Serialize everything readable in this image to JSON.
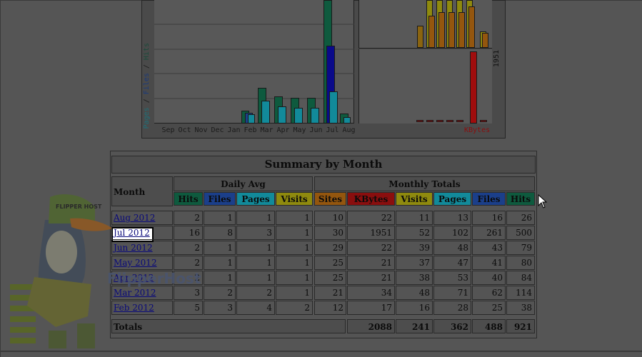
{
  "chart": {
    "y_label_pages": "Pages",
    "y_label_slash1": " / ",
    "y_label_files": "Files",
    "y_label_slash2": " / ",
    "y_label_hits": "Hits",
    "kbytes_max_label": "1951",
    "kbytes_label": "KBytes",
    "months": [
      "Sep",
      "Oct",
      "Nov",
      "Dec",
      "Jan",
      "Feb",
      "Mar",
      "Apr",
      "May",
      "Jun",
      "Jul",
      "Aug"
    ]
  },
  "table": {
    "title": "Summary by Month",
    "month_header": "Month",
    "daily_avg_header": "Daily Avg",
    "monthly_totals_header": "Monthly Totals",
    "daily_cols": [
      "Hits",
      "Files",
      "Pages",
      "Visits"
    ],
    "monthly_cols": [
      "Sites",
      "KBytes",
      "Visits",
      "Pages",
      "Files",
      "Hits"
    ],
    "col_colors": {
      "hits": "#0e5a3e",
      "files": "#1b3f8a",
      "pages": "#128a9a",
      "visits": "#8f8a0e",
      "sites": "#94560e",
      "kbytes": "#8a0e0e"
    },
    "rows": [
      {
        "month": "Aug 2012",
        "d_hits": "2",
        "d_files": "1",
        "d_pages": "1",
        "d_visits": "1",
        "sites": "10",
        "kbytes": "22",
        "visits": "11",
        "pages": "13",
        "files": "16",
        "hits": "26"
      },
      {
        "month": "Jul 2012",
        "d_hits": "16",
        "d_files": "8",
        "d_pages": "3",
        "d_visits": "1",
        "sites": "30",
        "kbytes": "1951",
        "visits": "52",
        "pages": "102",
        "files": "261",
        "hits": "500"
      },
      {
        "month": "Jun 2012",
        "d_hits": "2",
        "d_files": "1",
        "d_pages": "1",
        "d_visits": "1",
        "sites": "29",
        "kbytes": "22",
        "visits": "39",
        "pages": "48",
        "files": "43",
        "hits": "79"
      },
      {
        "month": "May 2012",
        "d_hits": "2",
        "d_files": "1",
        "d_pages": "1",
        "d_visits": "1",
        "sites": "25",
        "kbytes": "21",
        "visits": "37",
        "pages": "47",
        "files": "41",
        "hits": "80"
      },
      {
        "month": "Apr 2012",
        "d_hits": "2",
        "d_files": "1",
        "d_pages": "1",
        "d_visits": "1",
        "sites": "25",
        "kbytes": "21",
        "visits": "38",
        "pages": "53",
        "files": "40",
        "hits": "84"
      },
      {
        "month": "Mar 2012",
        "d_hits": "3",
        "d_files": "2",
        "d_pages": "2",
        "d_visits": "1",
        "sites": "21",
        "kbytes": "34",
        "visits": "48",
        "pages": "71",
        "files": "62",
        "hits": "114"
      },
      {
        "month": "Feb 2012",
        "d_hits": "5",
        "d_files": "3",
        "d_pages": "4",
        "d_visits": "2",
        "sites": "12",
        "kbytes": "17",
        "visits": "16",
        "pages": "28",
        "files": "25",
        "hits": "38"
      }
    ],
    "totals_label": "Totals",
    "totals": {
      "kbytes": "2088",
      "visits": "241",
      "pages": "362",
      "files": "488",
      "hits": "921"
    }
  },
  "mascot": {
    "cap_text": "FLIPPER HOST",
    "brand_text": "FlipperHost"
  }
}
